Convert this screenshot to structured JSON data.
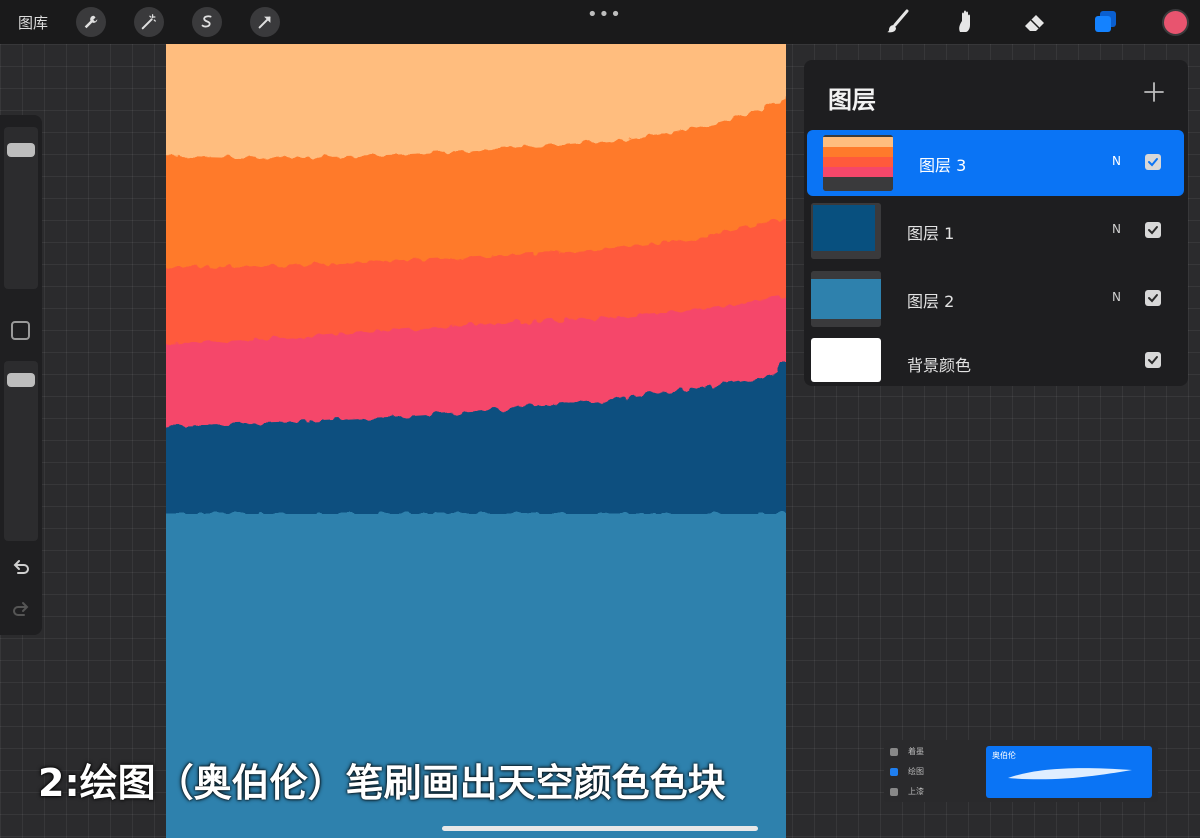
{
  "toolbar": {
    "gallery_label": "图库",
    "more_label": "•••",
    "left_tools": [
      "wrench-icon",
      "magic-wand-icon",
      "selection-icon",
      "transform-arrow-icon"
    ],
    "right_tools": [
      "brush-icon",
      "smudge-icon",
      "eraser-icon",
      "layers-icon"
    ],
    "current_color": "#e8546f",
    "accent": "#0a74f5"
  },
  "layers": {
    "title": "图层",
    "items": [
      {
        "name": "图层 3",
        "blend": "N",
        "visible": true,
        "active": true
      },
      {
        "name": "图层 1",
        "blend": "N",
        "visible": true,
        "active": false
      },
      {
        "name": "图层 2",
        "blend": "N",
        "visible": true,
        "active": false
      },
      {
        "name": "背景颜色",
        "blend": "",
        "visible": true,
        "active": false
      }
    ]
  },
  "canvas_colors": {
    "peach": "#ffbd7e",
    "orange": "#ff7a2b",
    "red_orange": "#ff5a3c",
    "pink": "#f5476a",
    "navy": "#08507f",
    "sea": "#2e81ad",
    "white": "#ffffff"
  },
  "caption": "2:绘图（奥伯伦）笔刷画出天空颜色色块",
  "brush_popup": {
    "categories": [
      "着墨",
      "绘图",
      "上漆"
    ],
    "active_category": "绘图",
    "selected_brush": "奥伯伦"
  }
}
